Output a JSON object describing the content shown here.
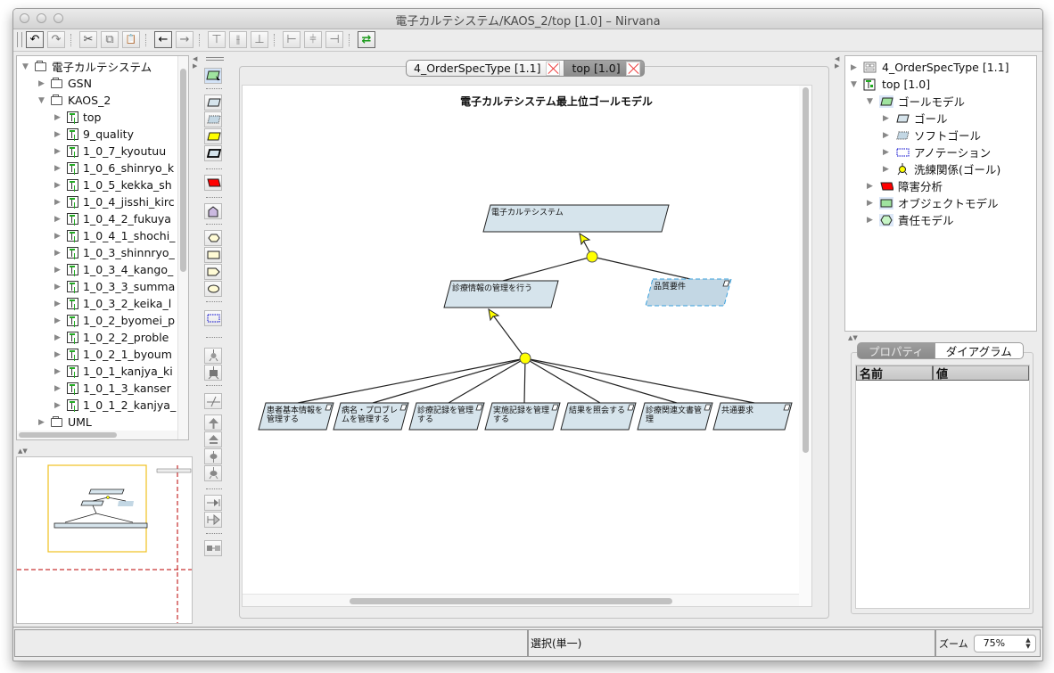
{
  "window": {
    "title": "電子カルテシステム/KAOS_2/top [1.0]  – Nirvana"
  },
  "toolbar": {
    "buttons": [
      {
        "name": "undo",
        "glyph": "↶"
      },
      {
        "name": "redo",
        "glyph": "↷"
      },
      {
        "name": "cut",
        "glyph": "✂"
      },
      {
        "name": "copy",
        "glyph": "⧉"
      },
      {
        "name": "paste",
        "glyph": "📋"
      },
      {
        "name": "back",
        "glyph": "←"
      },
      {
        "name": "forward",
        "glyph": "→"
      },
      {
        "name": "align-top",
        "glyph": "⊤"
      },
      {
        "name": "align-middle",
        "glyph": "⫲"
      },
      {
        "name": "align-bottom",
        "glyph": "⊥"
      },
      {
        "name": "align-left",
        "glyph": "⊢"
      },
      {
        "name": "align-center",
        "glyph": "⫩"
      },
      {
        "name": "align-right",
        "glyph": "⊣"
      },
      {
        "name": "sync",
        "glyph": "⇄"
      }
    ]
  },
  "model_tree": {
    "root": "電子カルテシステム",
    "items": [
      {
        "label": "電子カルテシステム",
        "type": "folder",
        "level": 0,
        "expanded": true
      },
      {
        "label": "GSN",
        "type": "folder",
        "level": 1,
        "expanded": false
      },
      {
        "label": "KAOS_2",
        "type": "folder",
        "level": 1,
        "expanded": true
      },
      {
        "label": "top",
        "type": "diagram",
        "level": 2,
        "expanded": false
      },
      {
        "label": "9_quality",
        "type": "diagram",
        "level": 2,
        "expanded": false
      },
      {
        "label": "1_0_7_kyoutuu",
        "type": "diagram",
        "level": 2,
        "expanded": false
      },
      {
        "label": "1_0_6_shinryo_k",
        "type": "diagram",
        "level": 2,
        "expanded": false
      },
      {
        "label": "1_0_5_kekka_sh",
        "type": "diagram",
        "level": 2,
        "expanded": false
      },
      {
        "label": "1_0_4_jisshi_kirc",
        "type": "diagram",
        "level": 2,
        "expanded": false
      },
      {
        "label": "1_0_4_2_fukuya",
        "type": "diagram",
        "level": 2,
        "expanded": false
      },
      {
        "label": "1_0_4_1_shochi_",
        "type": "diagram",
        "level": 2,
        "expanded": false
      },
      {
        "label": "1_0_3_shinnryo_",
        "type": "diagram",
        "level": 2,
        "expanded": false
      },
      {
        "label": "1_0_3_4_kango_",
        "type": "diagram",
        "level": 2,
        "expanded": false
      },
      {
        "label": "1_0_3_3_summa",
        "type": "diagram",
        "level": 2,
        "expanded": false
      },
      {
        "label": "1_0_3_2_keika_l",
        "type": "diagram",
        "level": 2,
        "expanded": false
      },
      {
        "label": "1_0_2_byomei_p",
        "type": "diagram",
        "level": 2,
        "expanded": false
      },
      {
        "label": "1_0_2_2_proble",
        "type": "diagram",
        "level": 2,
        "expanded": false
      },
      {
        "label": "1_0_2_1_byoum",
        "type": "diagram",
        "level": 2,
        "expanded": false
      },
      {
        "label": "1_0_1_kanjya_ki",
        "type": "diagram",
        "level": 2,
        "expanded": false
      },
      {
        "label": "1_0_1_3_kanser",
        "type": "diagram",
        "level": 2,
        "expanded": false
      },
      {
        "label": "1_0_1_2_kanjya_",
        "type": "diagram",
        "level": 2,
        "expanded": false
      },
      {
        "label": "UML",
        "type": "folder",
        "level": 1,
        "expanded": false
      }
    ]
  },
  "palette": {
    "tools": [
      "select",
      "goal",
      "soft-goal",
      "expectation",
      "requirement",
      "obstacle",
      "agent",
      "operation",
      "entity",
      "event",
      "domain-property",
      "annotation",
      "refinement",
      "or-refinement",
      "obstacle-refinement",
      "resolution",
      "conflict",
      "responsibility",
      "operationalization",
      "input",
      "output",
      "association"
    ]
  },
  "editor": {
    "tabs": [
      {
        "label": "4_OrderSpecType [1.1]",
        "active": false
      },
      {
        "label": "top [1.0]",
        "active": true
      }
    ],
    "diagram": {
      "title": "電子カルテシステム最上位ゴールモデル",
      "nodes": [
        {
          "id": "root",
          "lines": [
            "電子カルテシステム"
          ],
          "style": "goal"
        },
        {
          "id": "g1",
          "lines": [
            "診療情報の管理を行う"
          ],
          "style": "goal"
        },
        {
          "id": "q",
          "lines": [
            "品質要件"
          ],
          "style": "soft-goal"
        },
        {
          "id": "c1",
          "lines": [
            "患者基本情報を",
            "管理する"
          ],
          "style": "goal"
        },
        {
          "id": "c2",
          "lines": [
            "病名・プロブレ",
            "ムを管理する"
          ],
          "style": "goal"
        },
        {
          "id": "c3",
          "lines": [
            "診療記録を管理",
            "する"
          ],
          "style": "goal"
        },
        {
          "id": "c4",
          "lines": [
            "実施記録を管理",
            "する"
          ],
          "style": "goal"
        },
        {
          "id": "c5",
          "lines": [
            "結果を照会する"
          ],
          "style": "goal"
        },
        {
          "id": "c6",
          "lines": [
            "診療関連文書管",
            "理"
          ],
          "style": "goal"
        },
        {
          "id": "c7",
          "lines": [
            "共通要求"
          ],
          "style": "goal"
        }
      ],
      "refinements": [
        {
          "parent": "root",
          "children": [
            "g1",
            "q"
          ]
        },
        {
          "parent": "g1",
          "children": [
            "c1",
            "c2",
            "c3",
            "c4",
            "c5",
            "c6",
            "c7"
          ]
        }
      ],
      "colors": {
        "goal_fill": "#d6e4ec",
        "soft_fill": "#c3d7e4",
        "soft_stroke": "#3aa0dc",
        "refine": "#ffff00",
        "stroke": "#222222"
      }
    }
  },
  "diagram_tree": {
    "items": [
      {
        "label": "4_OrderSpecType [1.1]",
        "icon": "class-diagram",
        "level": 0,
        "expanded": false
      },
      {
        "label": "top [1.0]",
        "icon": "kaos-diagram",
        "level": 0,
        "expanded": true
      },
      {
        "label": "ゴールモデル",
        "icon": "goal-model",
        "level": 1,
        "expanded": true
      },
      {
        "label": "ゴール",
        "icon": "goal",
        "level": 2,
        "expanded": false
      },
      {
        "label": "ソフトゴール",
        "icon": "soft-goal",
        "level": 2,
        "expanded": false
      },
      {
        "label": "アノテーション",
        "icon": "annotation",
        "level": 2,
        "expanded": false
      },
      {
        "label": "洗練関係(ゴール)",
        "icon": "refinement",
        "level": 2,
        "expanded": false
      },
      {
        "label": "障害分析",
        "icon": "obstacle",
        "level": 1,
        "expanded": false
      },
      {
        "label": "オブジェクトモデル",
        "icon": "object-model",
        "level": 1,
        "expanded": false
      },
      {
        "label": "責任モデル",
        "icon": "responsibility",
        "level": 1,
        "expanded": false
      }
    ]
  },
  "properties": {
    "tabs": [
      {
        "label": "プロパティ",
        "selected": true
      },
      {
        "label": "ダイアグラム",
        "selected": false
      }
    ],
    "columns": [
      "名前",
      "値"
    ],
    "rows": []
  },
  "statusbar": {
    "left": "",
    "mode": "選択(単一)",
    "zoom_label": "ズーム",
    "zoom_value": "75%"
  }
}
